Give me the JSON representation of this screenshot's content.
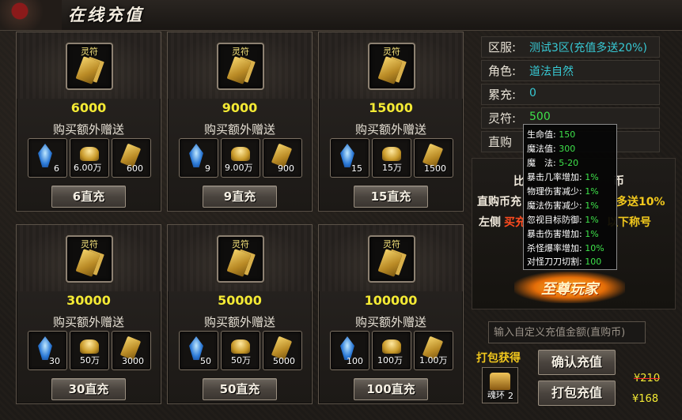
{
  "title": "在线充值",
  "cards": [
    {
      "slot_label": "灵符",
      "amount": "6000",
      "bonus_title": "购买额外赠送",
      "rewards": [
        "6",
        "6.00万",
        "600"
      ],
      "button": "6直充"
    },
    {
      "slot_label": "灵符",
      "amount": "9000",
      "bonus_title": "购买额外赠送",
      "rewards": [
        "9",
        "9.00万",
        "900"
      ],
      "button": "9直充"
    },
    {
      "slot_label": "灵符",
      "amount": "15000",
      "bonus_title": "购买额外赠送",
      "rewards": [
        "15",
        "15万",
        "1500"
      ],
      "button": "15直充"
    },
    {
      "slot_label": "灵符",
      "amount": "30000",
      "bonus_title": "购买额外赠送",
      "rewards": [
        "30",
        "50万",
        "3000"
      ],
      "button": "30直充"
    },
    {
      "slot_label": "灵符",
      "amount": "50000",
      "bonus_title": "购买额外赠送",
      "rewards": [
        "50",
        "50万",
        "5000"
      ],
      "button": "50直充"
    },
    {
      "slot_label": "灵符",
      "amount": "100000",
      "bonus_title": "购买额外赠送",
      "rewards": [
        "100",
        "100万",
        "1.00万"
      ],
      "button": "100直充"
    }
  ],
  "info": {
    "server_label": "区服:",
    "server_value": "测试3区(充值多送20%)",
    "role_label": "角色:",
    "role_value": "道法自然",
    "total_label": "累充:",
    "total_value": "0",
    "talisman_label": "灵符:",
    "talisman_value": "500",
    "direct_label": "直购"
  },
  "promo": {
    "line1_a": "比",
    "line1_b": "币",
    "line2_a": "直购币充",
    "line2_b": "多送10%",
    "line3_a": "左侧",
    "line3_b": "买充",
    "line3_c": "以下称号",
    "logo_text": "至尊玩家"
  },
  "tooltip": {
    "rows": [
      {
        "key": "生命值:",
        "val": "150"
      },
      {
        "key": "魔法值:",
        "val": "300"
      },
      {
        "key": "魔　法:",
        "val": "5-20"
      },
      {
        "key": "暴击几率增加:",
        "val": "1%"
      },
      {
        "key": "物理伤害减少:",
        "val": "1%"
      },
      {
        "key": "魔法伤害减少:",
        "val": "1%"
      },
      {
        "key": "忽视目标防御:",
        "val": "1%"
      },
      {
        "key": "暴击伤害增加:",
        "val": "1%"
      },
      {
        "key": "杀怪爆率增加:",
        "val": "10%"
      },
      {
        "key": "对怪刀刀切割:",
        "val": "100"
      }
    ]
  },
  "custom": {
    "placeholder": "输入自定义充值金额(直购币)",
    "pack_title": "打包获得",
    "pack_item_label": "魂环",
    "pack_item_qty": "2",
    "confirm_button": "确认充值",
    "pack_button": "打包充值",
    "price_old": "¥210",
    "price_new": "¥168"
  },
  "colors": {
    "amount": "#f4ea34",
    "info_value": "#37c9d4",
    "green_value": "#3ee24a",
    "highlight": "#f2c81d"
  }
}
